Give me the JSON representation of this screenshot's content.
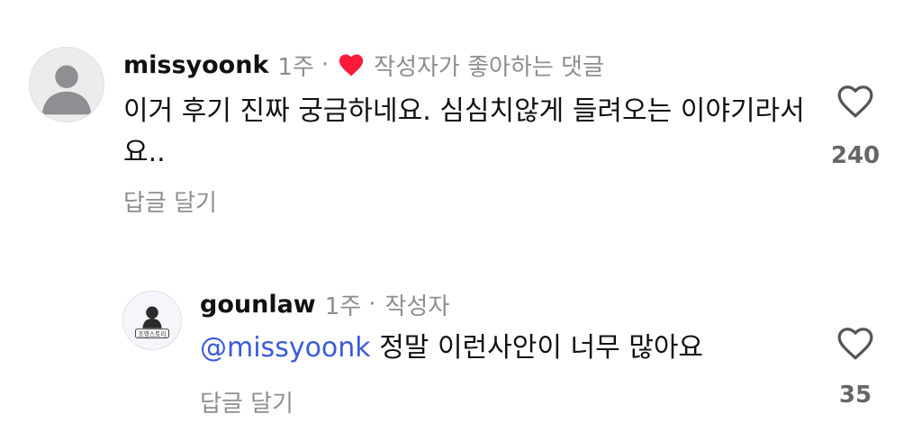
{
  "comments": [
    {
      "username": "missyoonk",
      "time": "1주",
      "separator": "·",
      "badge": "작성자가 좋아하는 댓글",
      "text": "이거 후기 진짜 궁금하네요. 심심치않게 들려오는 이야기라서요..",
      "reply_label": "답글 달기",
      "like_count": "240"
    },
    {
      "username": "gounlaw",
      "time": "1주",
      "separator": "·",
      "badge": "작성자",
      "mention": "@missyoonk",
      "text": " 정말 이런사안이 너무 많아요",
      "reply_label": "답글 달기",
      "like_count": "35",
      "avatar_text": "조영스토리"
    }
  ],
  "colors": {
    "heart_liked": "#ff1a3a",
    "mention": "#3b5bd9",
    "muted": "#8e8e8e"
  }
}
